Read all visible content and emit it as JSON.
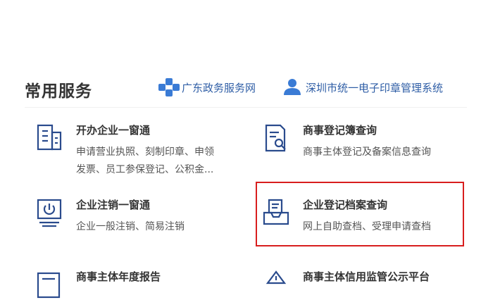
{
  "section": {
    "title": "常用服务"
  },
  "links": {
    "gd": "广东政务服务网",
    "sz": "深圳市统一电子印章管理系统"
  },
  "services": [
    {
      "title": "开办企业一窗通",
      "desc_line1": "申请营业执照、刻制印章、申领",
      "desc_line2": "发票、员工参保登记、公积金..."
    },
    {
      "title": "商事登记簿查询",
      "desc_line1": "商事主体登记及备案信息查询"
    },
    {
      "title": "企业注销一窗通",
      "desc_line1": "企业一般注销、简易注销"
    },
    {
      "title": "企业登记档案查询",
      "desc_line1": "网上自助查档、受理申请查档"
    },
    {
      "title": "商事主体年度报告"
    },
    {
      "title": "商事主体信用监管公示平台"
    }
  ],
  "colors": {
    "link": "#2f5ea6",
    "icon": "#2a4b8d",
    "highlight": "#d81e1e"
  }
}
